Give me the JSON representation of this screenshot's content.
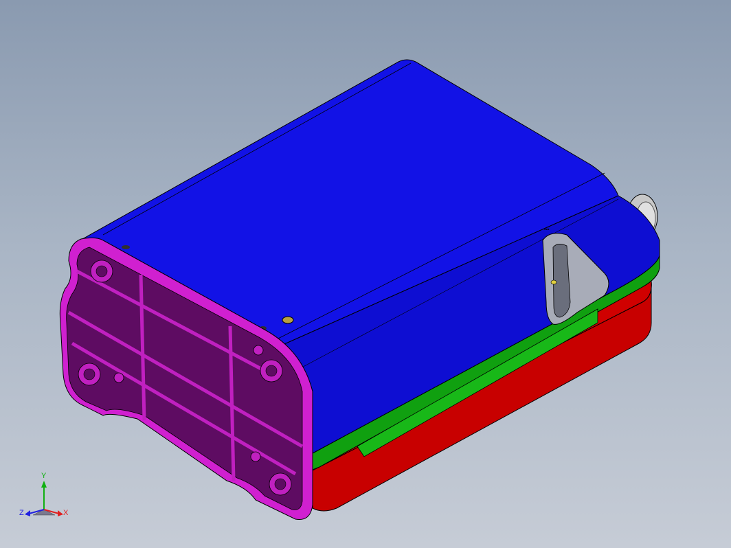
{
  "viewport": {
    "background_top": "#8a9ab0",
    "background_bottom": "#c6ccd6"
  },
  "model": {
    "colors": {
      "top_cover": "#1010e0",
      "top_cover_dark": "#0c0cc0",
      "end_cap": "#d020d0",
      "end_cap_face": "#5a0a5a",
      "green_band": "#10a010",
      "red_base": "#d00000",
      "handle": "#a8acb8",
      "edge_line": "#000000"
    }
  },
  "triad": {
    "y_label": "Y",
    "x_label": "X",
    "z_label": "Z",
    "colors": {
      "y": "#10b010",
      "x": "#e02020",
      "z": "#2020e0"
    }
  }
}
